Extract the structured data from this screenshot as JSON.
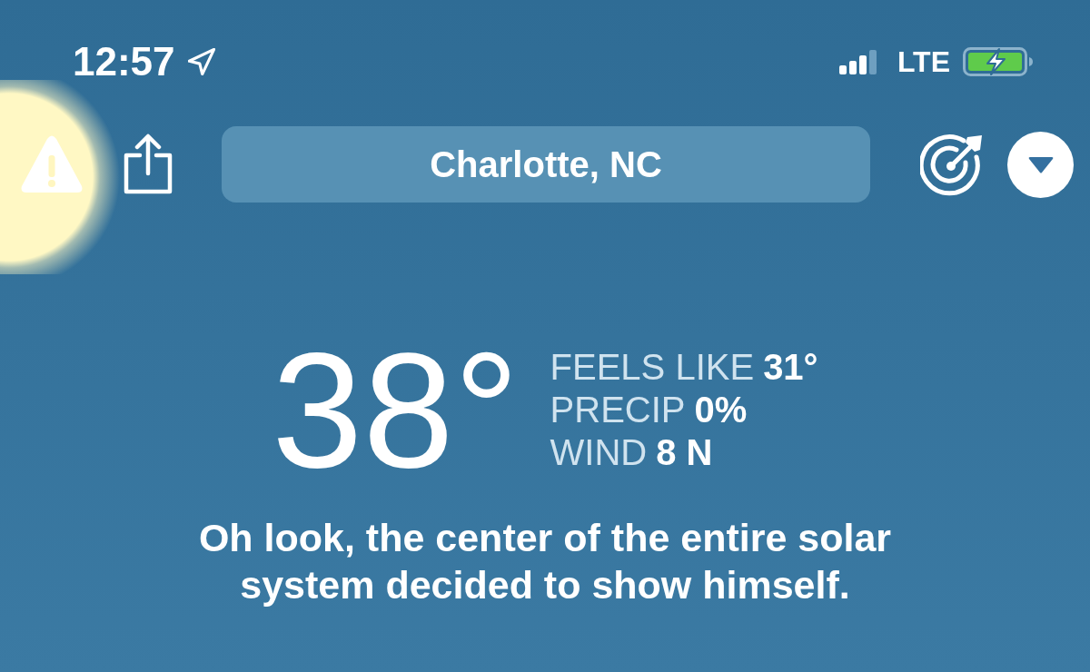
{
  "status_bar": {
    "time": "12:57",
    "network": "LTE"
  },
  "toolbar": {
    "location": "Charlotte, NC"
  },
  "current": {
    "temperature": "38°",
    "details": [
      {
        "label": "FEELS LIKE",
        "value": "31°"
      },
      {
        "label": "PRECIP",
        "value": "0%"
      },
      {
        "label": "WIND",
        "value": "8 N"
      }
    ]
  },
  "message": "Oh look, the center of the entire solar system decided to show himself."
}
